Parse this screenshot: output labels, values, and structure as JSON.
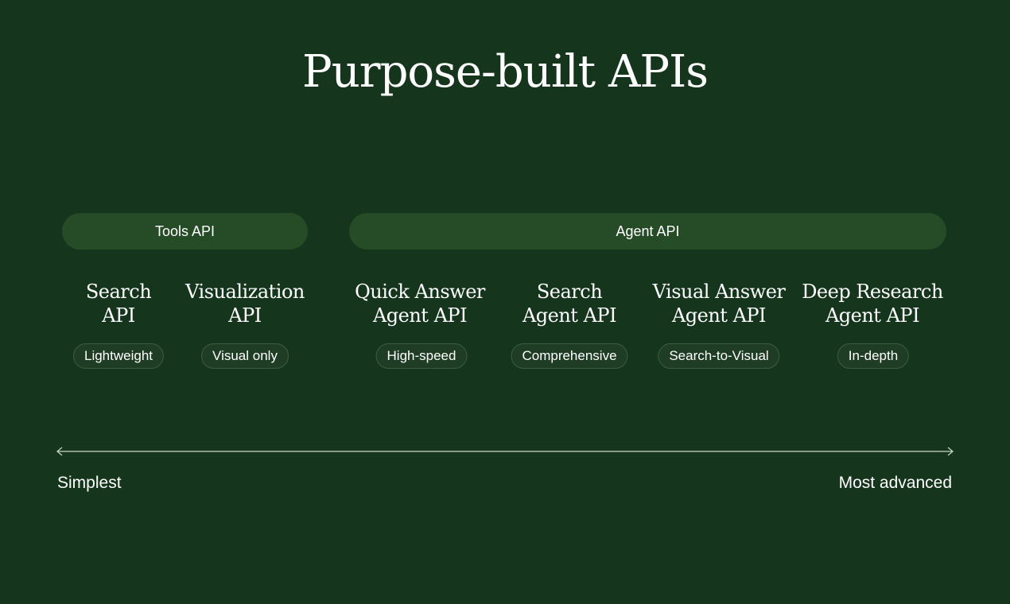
{
  "title": "Purpose-built APIs",
  "groups": {
    "tools": "Tools API",
    "agent": "Agent API"
  },
  "apis": [
    {
      "line1": "Search",
      "line2": "API",
      "tag": "Lightweight"
    },
    {
      "line1": "Visualization",
      "line2": "API",
      "tag": "Visual only"
    },
    {
      "line1": "Quick Answer",
      "line2": "Agent API",
      "tag": "High-speed"
    },
    {
      "line1": "Search",
      "line2": "Agent API",
      "tag": "Comprehensive"
    },
    {
      "line1": "Visual Answer",
      "line2": "Agent API",
      "tag": "Search-to-Visual"
    },
    {
      "line1": "Deep Research",
      "line2": "Agent API",
      "tag": "In-depth"
    }
  ],
  "scale": {
    "left": "Simplest",
    "right": "Most advanced"
  },
  "colors": {
    "background": "#15361c",
    "group_pill": "#264c27",
    "tag_bg": "#1f3d24",
    "tag_border": "#3e5b42",
    "scale_line": "#c9d6c9"
  }
}
